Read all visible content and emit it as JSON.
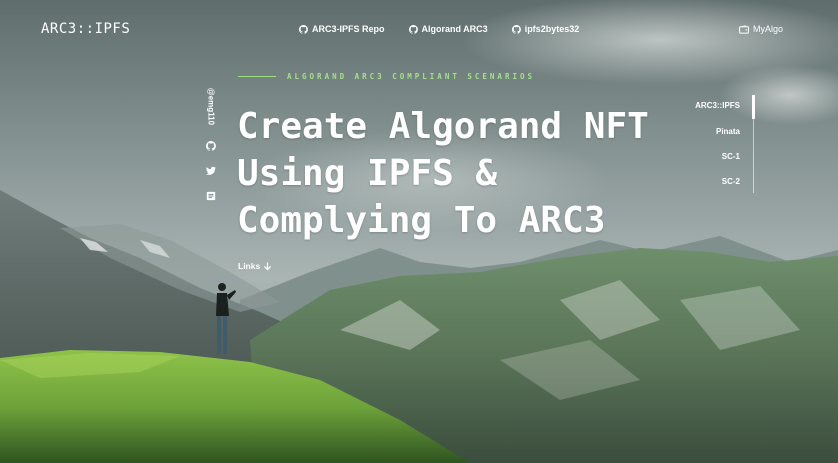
{
  "brand": {
    "logo_text": "ARC3::IPFS"
  },
  "topnav": {
    "items": [
      {
        "label": "ARC3-IPFS Repo",
        "icon": "github-icon"
      },
      {
        "label": "Algorand ARC3",
        "icon": "github-icon"
      },
      {
        "label": "ipfs2bytes32",
        "icon": "github-icon"
      }
    ],
    "wallet": {
      "label": "MyAlgo",
      "icon": "wallet-icon"
    }
  },
  "hero": {
    "eyebrow": "ALGORAND ARC3 COMPLIANT SCENARIOS",
    "headline_lines": [
      "Create Algorand NFT",
      "Using IPFS &",
      "Complying To ARC3"
    ],
    "cta_label": "Links",
    "cta_icon": "arrow-down-icon"
  },
  "social": {
    "handle": "@emg110",
    "icons": [
      "github-icon",
      "twitter-icon",
      "document-icon"
    ]
  },
  "sidenav": {
    "items": [
      "ARC3::IPFS",
      "Pinata",
      "SC-1",
      "SC-2"
    ],
    "active_index": 0
  },
  "colors": {
    "accent": "#a3e08a",
    "text": "#ffffff"
  }
}
